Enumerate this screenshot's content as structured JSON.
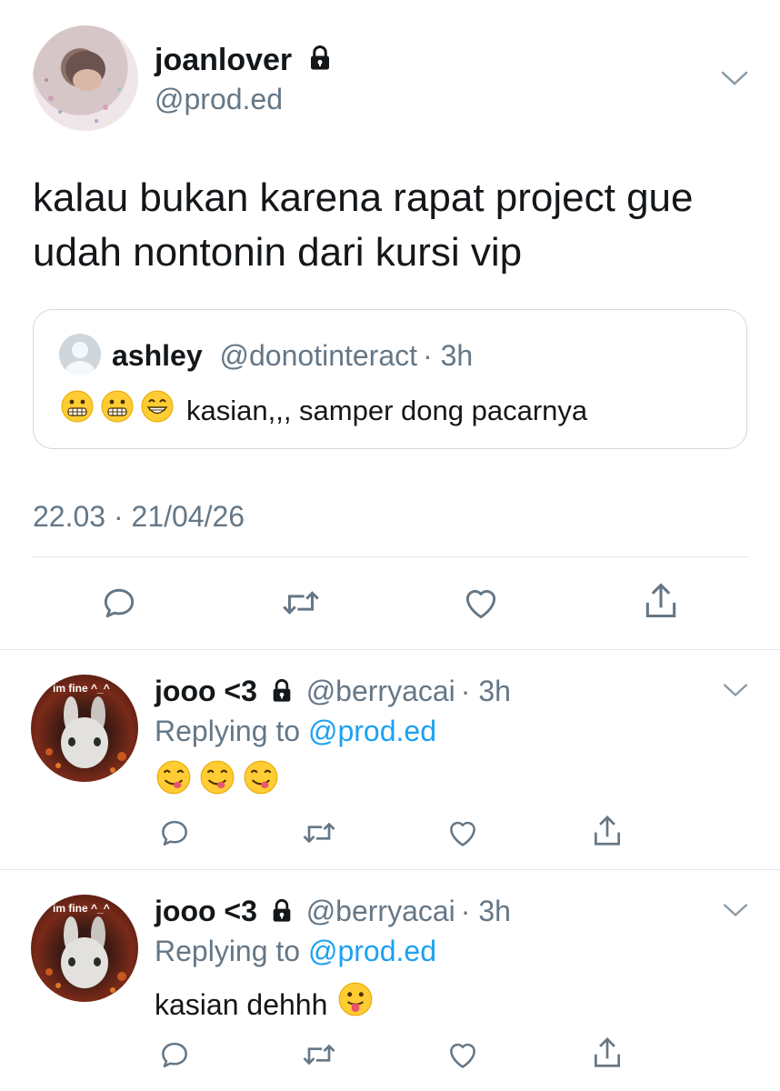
{
  "main_tweet": {
    "display_name": "joanlover",
    "handle": "@prod.ed",
    "text_line1": "kalau bukan karena rapat project gue",
    "text_line2": "udah nontonin dari kursi vip",
    "timestamp": "22.03 · 21/04/26"
  },
  "quoted_tweet": {
    "display_name": "ashley",
    "handle": "@donotinteract",
    "time": "· 3h",
    "text": "kasian,,, samper dong pacarnya",
    "emoji_icons": [
      "grimacing-face-icon",
      "grimacing-face-icon",
      "grinning-face-icon"
    ]
  },
  "replies": [
    {
      "display_name": "jooo <3",
      "handle": "@berryacai",
      "time": "· 3h",
      "replying_prefix": "Replying to",
      "replying_handle": "@prod.ed",
      "avatar_caption": "im fine ^_^",
      "text": "",
      "emoji_icons": [
        "yum-face-icon",
        "yum-face-icon",
        "yum-face-icon"
      ]
    },
    {
      "display_name": "jooo <3",
      "handle": "@berryacai",
      "time": "· 3h",
      "replying_prefix": "Replying to",
      "replying_handle": "@prod.ed",
      "avatar_caption": "im fine ^_^",
      "text": "kasian dehhh",
      "emoji_icons": [
        "tongue-out-face-icon"
      ]
    }
  ],
  "colors": {
    "text": "#14171a",
    "secondary": "#657786",
    "link": "#1da1f2",
    "divider": "#e1e8ed",
    "icon": "#657786"
  }
}
